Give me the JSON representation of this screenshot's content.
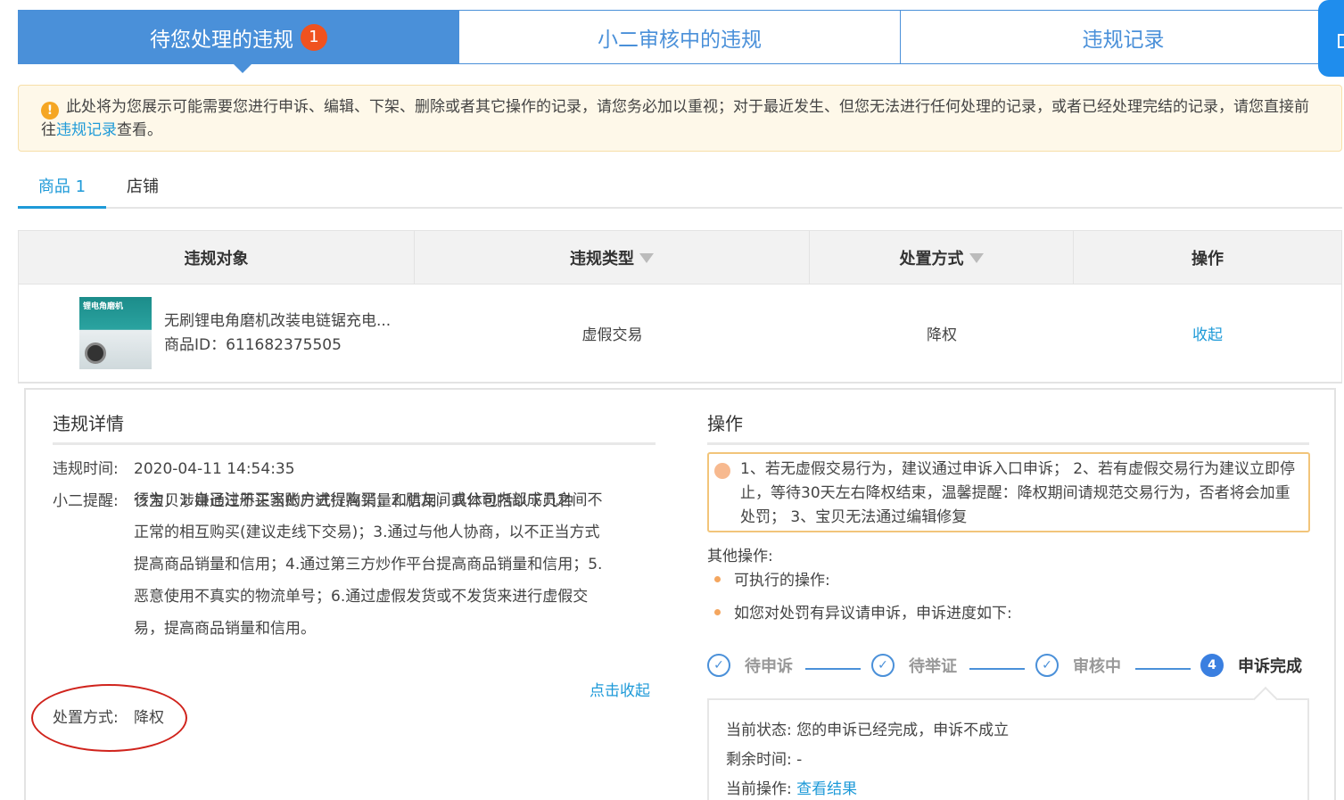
{
  "top_tabs": [
    {
      "label": "待您处理的违规",
      "badge": "1"
    },
    {
      "label": "小二审核中的违规"
    },
    {
      "label": "违规记录"
    }
  ],
  "notice": {
    "icon": "warning-icon",
    "text_before": "此处将为您展示可能需要您进行申诉、编辑、下架、删除或者其它操作的记录，请您务必加以重视；对于最近发生、但您无法进行任何处理的记录，或者已经处理完结的记录，请您直接前往",
    "link": "违规记录",
    "text_after": "查看。"
  },
  "sub_tabs": [
    {
      "label": "商品 1"
    },
    {
      "label": "店铺"
    }
  ],
  "table": {
    "headers": [
      "违规对象",
      "违规类型",
      "处置方式",
      "操作"
    ],
    "row": {
      "thumb_text": "锂电角磨机",
      "product_name": "无刷锂电角磨机改装电链锯充电...",
      "product_id": "商品ID：611682375505",
      "violation_type": "虚假交易",
      "handling": "降权",
      "action": "收起"
    }
  },
  "detail": {
    "title": "违规详情",
    "time_label": "违规时间:",
    "time_value": "2020-04-11 14:54:35",
    "remind_label": "小二提醒:",
    "remind_first": "该宝贝涉嫌通过不正当的方式提高销量和信用，具体包括以下几种",
    "remind_body": "行为：1.自己注册买家账户进行购买；2.朋友间或公司内部成员之间不正常的相互购买(建议走线下交易)；3.通过与他人协商，以不正当方式提高商品销量和信用；4.通过第三方炒作平台提高商品销量和信用；5.恶意使用不真实的物流单号；6.通过虚假发货或不发货来进行虚假交易，提高商品销量和信用。",
    "collapse": "点击收起",
    "handling_label": "处置方式:",
    "handling_value": "降权"
  },
  "operation": {
    "title": "操作",
    "tip": "1、若无虚假交易行为，建议通过申诉入口申诉； 2、若有虚假交易行为建议立即停止，等待30天左右降权结束，温馨提醒：降权期间请规范交易行为，否者将会加重处罚； 3、宝贝无法通过编辑修复",
    "other_title": "其他操作:",
    "bullets": [
      "可执行的操作:",
      "如您对处罚有异议请申诉，申诉进度如下:"
    ],
    "steps": [
      {
        "label": "待申诉",
        "mark": "✓"
      },
      {
        "label": "待举证",
        "mark": "✓"
      },
      {
        "label": "审核中",
        "mark": "✓"
      },
      {
        "label": "申诉完成",
        "mark": "4"
      }
    ],
    "status": {
      "state_label": "当前状态:",
      "state_value": "您的申诉已经完成，申诉不成立",
      "remain_label": "剩余时间:",
      "remain_value": "-",
      "op_label": "当前操作:",
      "op_link": "查看结果"
    }
  },
  "colors": {
    "primary": "#4a90d9",
    "link": "#1e9ad8",
    "badge": "#f0521f",
    "warning": "#f5a623",
    "annotation": "#d0231c"
  }
}
